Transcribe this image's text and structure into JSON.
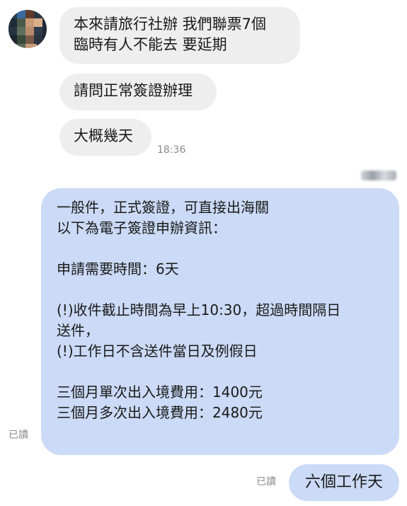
{
  "incoming": {
    "messages": [
      {
        "text": "本來請旅行社辦 我們聯票7個\n臨時有人不能去 要延期"
      },
      {
        "text": "請問正常簽證辦理"
      },
      {
        "text": "大概幾天"
      }
    ],
    "timestamp": "18:36"
  },
  "outgoing": {
    "info_lines": [
      "一般件，正式簽證，可直接出海關",
      "以下為電子簽證申辦資訊：",
      "",
      "申請需要時間：6天",
      "",
      "(!)收件截止時間為早上10:30，超過時間隔日",
      "送件，",
      "(!)工作日不含送件當日及例假日",
      "",
      "三個月單次出入境費用：1400元",
      "三個月多次出入境費用：2480元"
    ],
    "read_label": "已讀",
    "reply_text": "六個工作天",
    "reply_read_label": "已讀"
  },
  "colors": {
    "incoming_bubble": "#eeeeef",
    "outgoing_bubble": "#cbdaf6",
    "meta_text": "#8a8a8a"
  }
}
